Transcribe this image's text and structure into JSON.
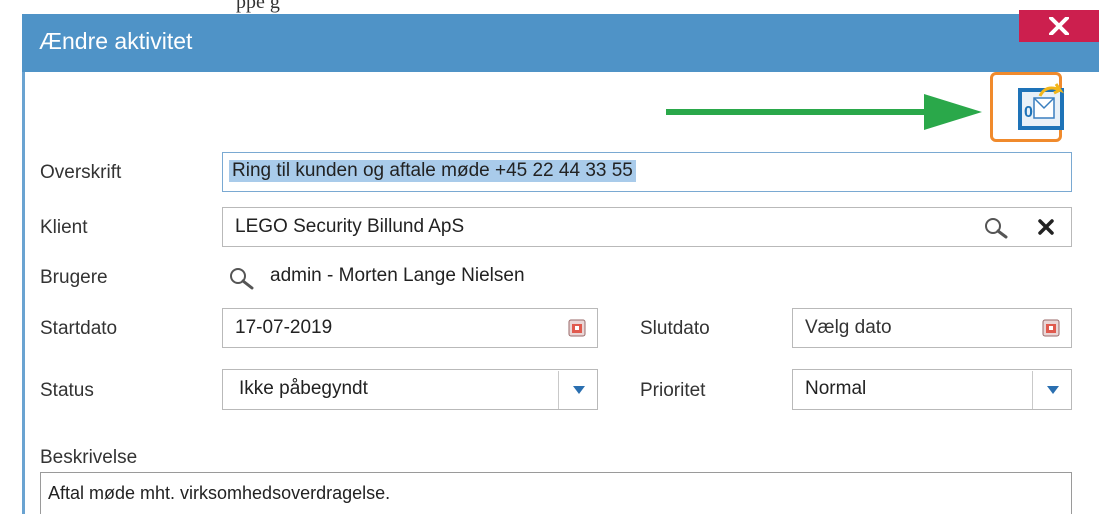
{
  "background_fragment": "ppe       g",
  "dialog": {
    "title": "Ændre aktivitet",
    "colors": {
      "titlebar": "#4f93c7",
      "close": "#cc1f4e",
      "highlight": "#f08a2c",
      "arrow": "#2aa84a"
    },
    "close_icon": "close-icon",
    "outlook_icon": "outlook-send-icon"
  },
  "form": {
    "headline": {
      "label": "Overskrift",
      "value": "Ring til kunden og aftale møde +45 22 44 33 55"
    },
    "client": {
      "label": "Klient",
      "value": "LEGO Security Billund ApS"
    },
    "users": {
      "label": "Brugere",
      "value": "admin - Morten Lange Nielsen"
    },
    "start_date": {
      "label": "Startdato",
      "value": "17-07-2019"
    },
    "end_date": {
      "label": "Slutdato",
      "placeholder": "Vælg dato"
    },
    "status": {
      "label": "Status",
      "value": "Ikke påbegyndt"
    },
    "priority": {
      "label": "Prioritet",
      "value": "Normal"
    },
    "description": {
      "label": "Beskrivelse",
      "value": "Aftal møde mht. virksomhedsoverdragelse."
    }
  }
}
